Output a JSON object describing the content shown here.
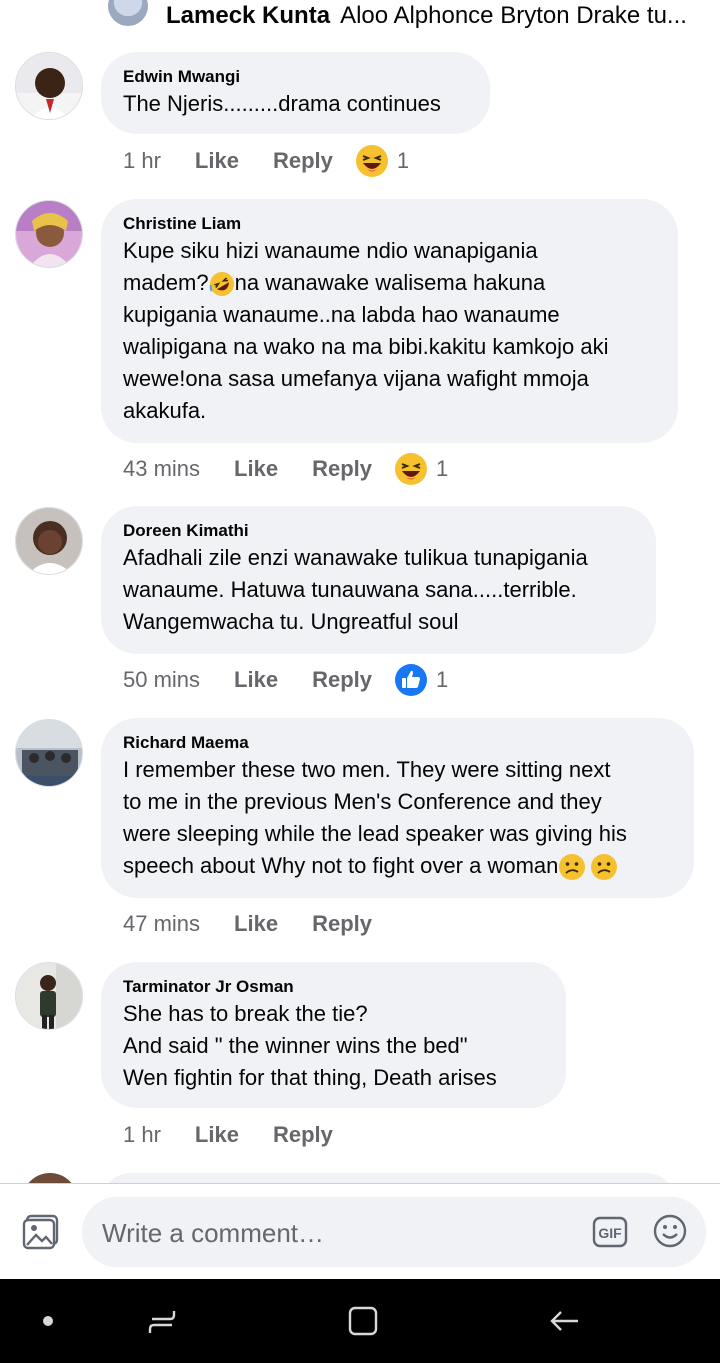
{
  "top_reply": {
    "author": "Lameck Kunta",
    "text": "Aloo Alphonce Bryton Drake tu..."
  },
  "comments": [
    {
      "author": "Edwin Mwangi",
      "text": "The Njeris.........drama continues",
      "time": "1 hr",
      "like_label": "Like",
      "reply_label": "Reply",
      "reaction": "haha",
      "reaction_count": "1"
    },
    {
      "author": "Christine Liam",
      "text_part1": "Kupe siku hizi wanaume ndio wanapigania\nmadem?",
      "text_part2": "na wanawake walisema hakuna\nkupigania wanaume..na labda hao wanaume\nwalipigana na wako na ma bibi.kakitu kamkojo aki\nwewe!ona sasa umefanya vijana wafight mmoja\nakakufa.",
      "time": "43 mins",
      "like_label": "Like",
      "reply_label": "Reply",
      "reaction": "haha",
      "reaction_count": "1"
    },
    {
      "author": "Doreen Kimathi",
      "text": "Afadhali zile enzi wanawake tulikua tunapigania\nwanaume. Hatuwa tunauwana sana.....terrible.\nWangemwacha tu. Ungreatful soul",
      "time": "50 mins",
      "like_label": "Like",
      "reply_label": "Reply",
      "reaction": "like",
      "reaction_count": "1"
    },
    {
      "author": "Richard Maema",
      "text": "I remember these two men. They were sitting next\nto me in the previous Men's Conference and they\nwere sleeping while the lead speaker was giving his\nspeech about Why not to fight over a woman",
      "time": "47 mins",
      "like_label": "Like",
      "reply_label": "Reply"
    },
    {
      "author": "Tarminator Jr Osman",
      "text": "She has to break the tie?\nAnd said \" the winner wins the bed\"\nWen fightin for that thing,  Death arises",
      "time": "1 hr",
      "like_label": "Like",
      "reply_label": "Reply"
    }
  ],
  "composer": {
    "placeholder": "Write a comment…"
  },
  "icons": {
    "photo": "photo-icon",
    "gif": "gif-icon",
    "emoji": "smiley-icon",
    "nav": [
      "dot-icon",
      "recent-apps-icon",
      "home-icon",
      "back-icon"
    ]
  },
  "colors": {
    "bubble": "#f0f2f5",
    "meta_text": "#65676b",
    "like_blue": "#1877f2",
    "haha_yellow": "#f7c02f",
    "navbar": "#000000"
  }
}
